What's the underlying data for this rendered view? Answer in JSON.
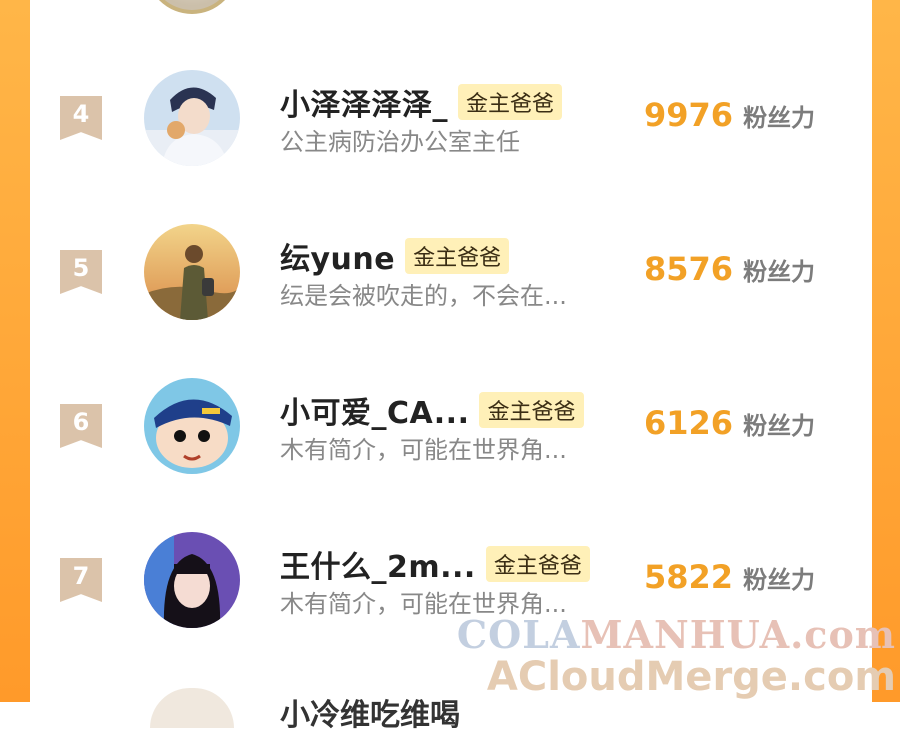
{
  "rows": [
    {
      "rank": "4",
      "name": "小泽泽泽泽_",
      "badge": "金主爸爸",
      "bio": "公主病防治办公室主任",
      "score": "9976",
      "unit": "粉丝力"
    },
    {
      "rank": "5",
      "name": "纭yune",
      "badge": "金主爸爸",
      "bio": "纭是会被吹走的，不会在...",
      "score": "8576",
      "unit": "粉丝力"
    },
    {
      "rank": "6",
      "name": "小可爱_CA...",
      "badge": "金主爸爸",
      "bio": "木有简介，可能在世界角...",
      "score": "6126",
      "unit": "粉丝力"
    },
    {
      "rank": "7",
      "name": "王什么_2m...",
      "badge": "金主爸爸",
      "bio": "木有简介，可能在世界角...",
      "score": "5822",
      "unit": "粉丝力"
    }
  ],
  "next_row_partial_name": "小冷维吃维喝",
  "watermark": {
    "line1_a": "COLA",
    "line1_b": "MANHUA.com",
    "line2": "ACloudMerge.com"
  },
  "colors": {
    "frame": "#ff9f2f",
    "score": "#f2a126",
    "badge_bg": "#fff0b8",
    "rank_bg": "#dbc3aa"
  }
}
